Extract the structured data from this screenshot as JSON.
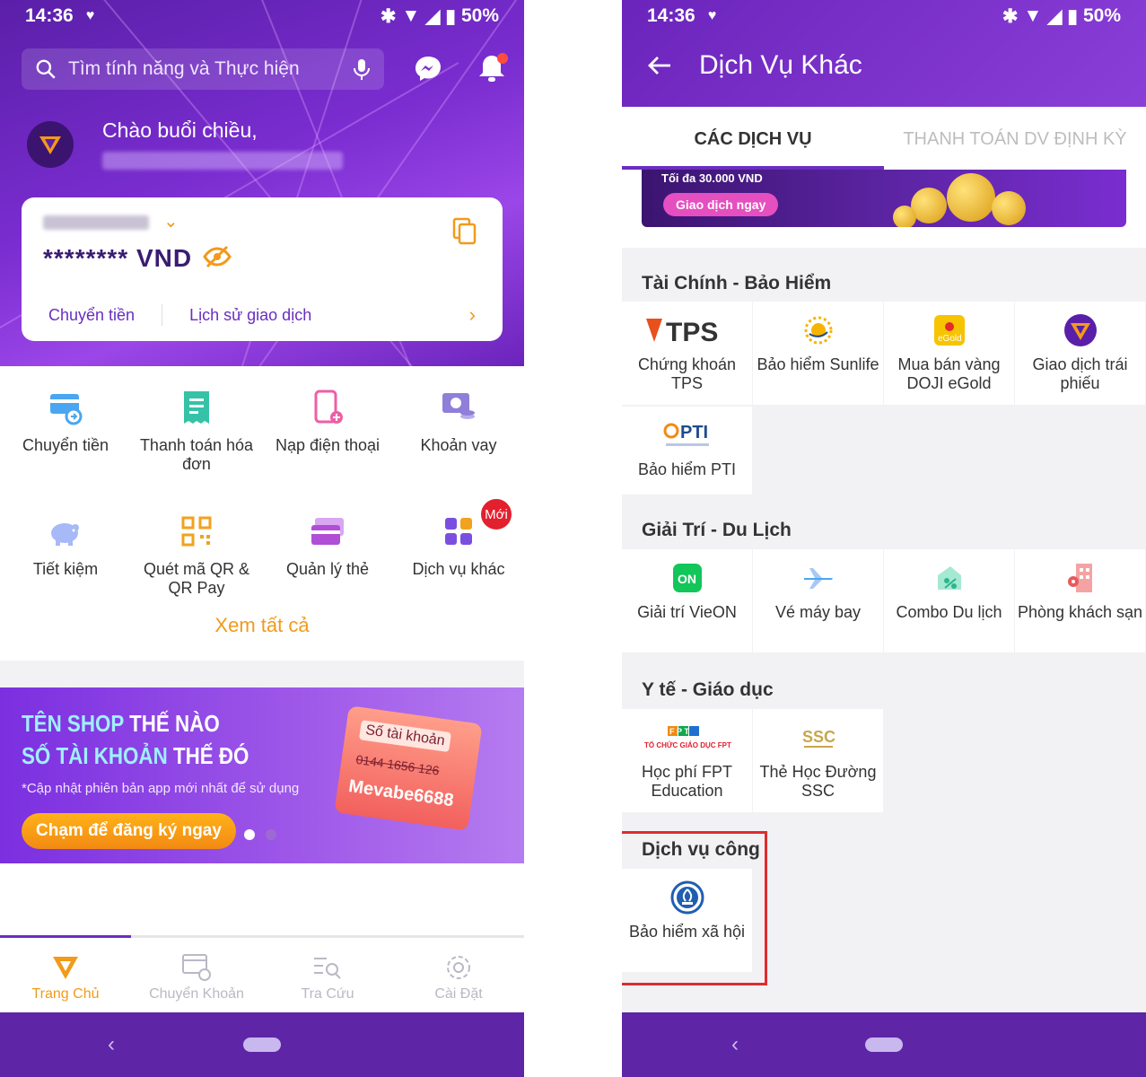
{
  "status": {
    "time": "14:36",
    "battery": "50%"
  },
  "left": {
    "search": {
      "placeholder": "Tìm tính năng và Thực hiện"
    },
    "greeting": "Chào buổi chiều,",
    "account": {
      "balance": "******** VND",
      "transfer_link": "Chuyển tiền",
      "history_link": "Lịch sử giao dịch"
    },
    "features": [
      {
        "label": "Chuyển tiền",
        "icon": "transfer-card-icon"
      },
      {
        "label": "Thanh toán hóa đơn",
        "icon": "bill-icon"
      },
      {
        "label": "Nạp điện thoại",
        "icon": "phone-topup-icon"
      },
      {
        "label": "Khoản vay",
        "icon": "loan-icon"
      },
      {
        "label": "Tiết kiệm",
        "icon": "piggy-bank-icon"
      },
      {
        "label": "Quét mã QR & QR Pay",
        "icon": "qr-icon"
      },
      {
        "label": "Quản lý thẻ",
        "icon": "card-manage-icon"
      },
      {
        "label": "Dịch vụ khác",
        "icon": "other-services-icon",
        "badge": "Mới"
      }
    ],
    "see_all": "Xem tất cả",
    "banner": {
      "line1a": "TÊN SHOP",
      "line1b": " THẾ NÀO",
      "line2a": "SỐ TÀI KHOẢN",
      "line2b": " THẾ ĐÓ",
      "note": "*Cập nhật phiên bản app mới nhất để sử dụng",
      "cta": "Chạm để đăng ký ngay",
      "card_title": "Số tài khoản",
      "card_number": "0144 1656 126",
      "card_name": "Mevabe6688"
    },
    "tabs": [
      {
        "label": "Trang Chủ",
        "active": true
      },
      {
        "label": "Chuyển Khoản"
      },
      {
        "label": "Tra Cứu"
      },
      {
        "label": "Cài Đặt"
      }
    ]
  },
  "right": {
    "title": "Dịch Vụ Khác",
    "tabs": [
      "CÁC DỊCH VỤ",
      "THANH TOÁN DV ĐỊNH KỲ"
    ],
    "promo": {
      "caption": "Tối đa 30.000 VND",
      "button": "Giao dịch ngay"
    },
    "sections": [
      {
        "title": "Tài Chính - Bảo Hiểm",
        "items": [
          {
            "label": "Chứng khoán TPS",
            "logo": "TPS"
          },
          {
            "label": "Bảo hiểm Sunlife",
            "logo": "sunlife-icon"
          },
          {
            "label": "Mua bán vàng DOJI eGold",
            "logo": "eGold"
          },
          {
            "label": "Giao dịch trái phiếu",
            "logo": "bond-icon"
          },
          {
            "label": "Bảo hiểm PTI",
            "logo": "PTI"
          }
        ]
      },
      {
        "title": "Giải Trí - Du Lịch",
        "items": [
          {
            "label": "Giải trí VieON",
            "logo": "ON"
          },
          {
            "label": "Vé máy bay",
            "logo": "plane-icon"
          },
          {
            "label": "Combo Du lịch",
            "logo": "combo-icon"
          },
          {
            "label": "Phòng khách sạn",
            "logo": "hotel-icon"
          }
        ]
      },
      {
        "title": "Y tế - Giáo dục",
        "items": [
          {
            "label": "Học phí FPT Education",
            "logo": "FPT"
          },
          {
            "label": "Thẻ Học Đường SSC",
            "logo": "SSC"
          }
        ]
      },
      {
        "title": "Dịch vụ công",
        "items": [
          {
            "label": "Bảo hiểm xã hội",
            "logo": "social-insurance-icon"
          }
        ]
      }
    ]
  },
  "colors": {
    "primary": "#6a2ec0",
    "accent": "#f29a1a",
    "highlight": "#e02c2c"
  }
}
